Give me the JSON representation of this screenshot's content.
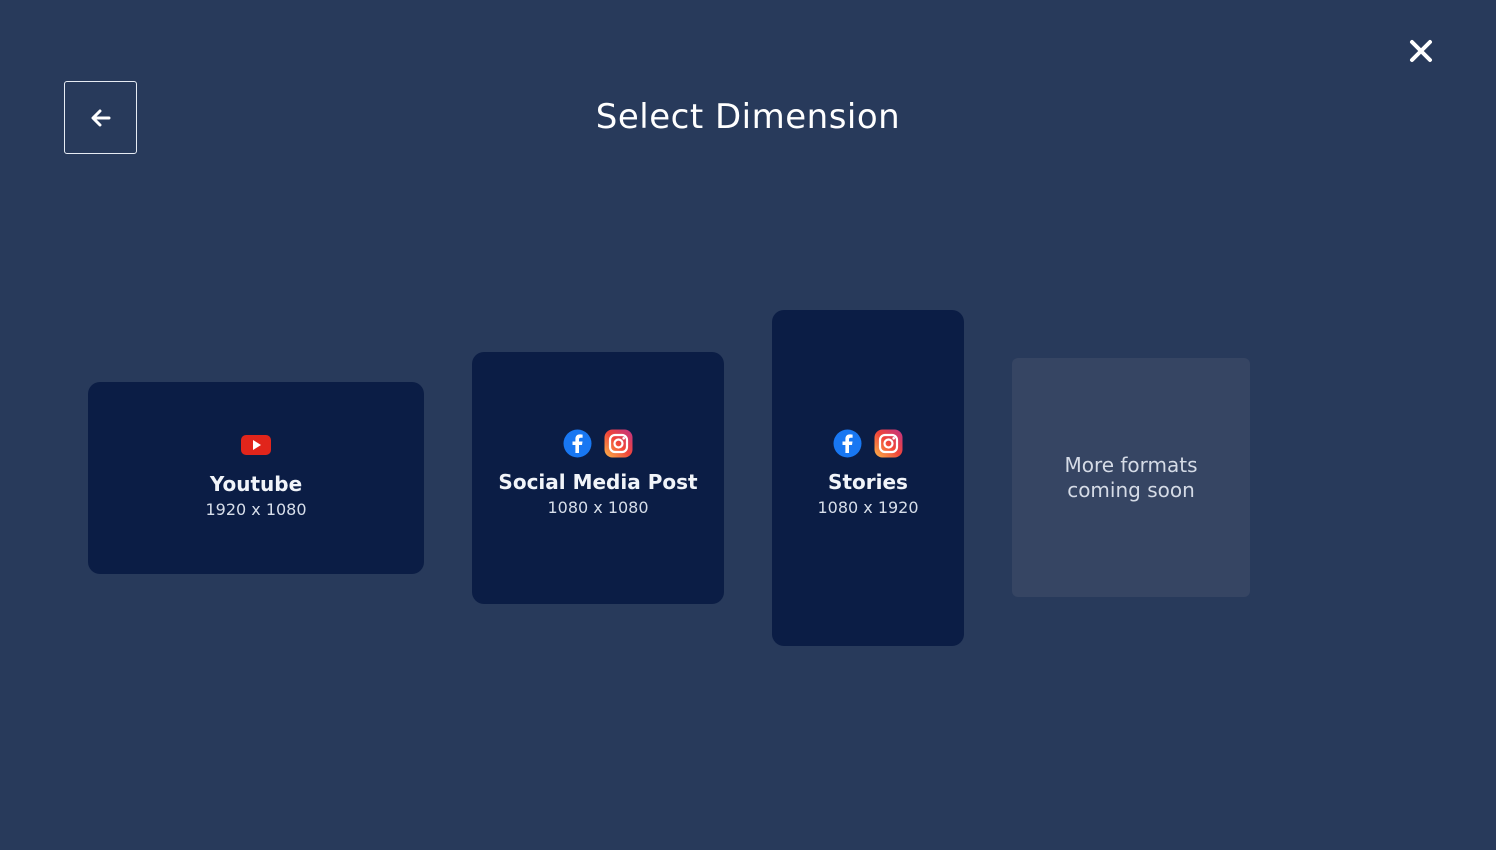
{
  "header": {
    "title": "Select Dimension"
  },
  "cards": [
    {
      "title": "Youtube",
      "dimension": "1920 x 1080"
    },
    {
      "title": "Social Media Post",
      "dimension": "1080 x 1080"
    },
    {
      "title": "Stories",
      "dimension": "1080 x 1920"
    }
  ],
  "placeholder": {
    "line1": "More formats",
    "line2": "coming soon"
  },
  "icons": {
    "close": "close-icon",
    "back": "arrow-left-icon",
    "youtube": "youtube-icon",
    "facebook": "facebook-icon",
    "instagram": "instagram-icon"
  },
  "colors": {
    "background": "#283a5b",
    "card": "#0b1d45",
    "placeholder_card": "#364563",
    "youtube_red": "#e1251b",
    "facebook_blue": "#1877f2"
  }
}
